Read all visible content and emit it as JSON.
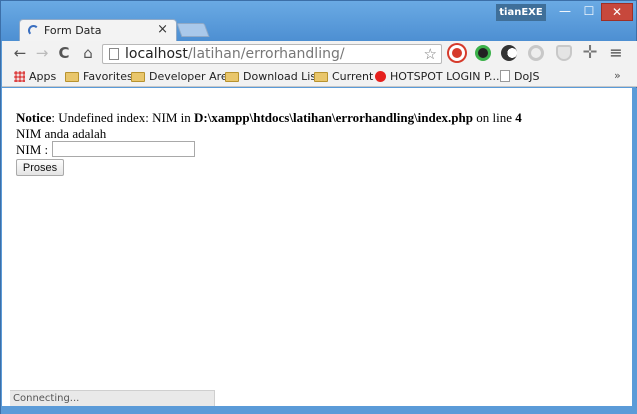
{
  "window": {
    "tab_title": "Form Data",
    "tab_close": "×",
    "user_name": "tianEXE",
    "min": "—",
    "max": "☐",
    "close": "✕"
  },
  "toolbar": {
    "back": "←",
    "forward": "→",
    "reload": "C",
    "home": "⌂",
    "url_host": "localhost",
    "url_path": "/latihan/errorhandling/",
    "star": "☆",
    "extensions_icons": [
      "record-icon",
      "speedometer-icon",
      "moon-icon",
      "circle-icon",
      "shield-icon",
      "crosshair-icon"
    ],
    "menu": "≡"
  },
  "bookmarks": {
    "items": [
      {
        "label": "Apps",
        "icon": "apps-grid-icon"
      },
      {
        "label": "Favorites",
        "icon": "folder-icon"
      },
      {
        "label": "Developer Area",
        "icon": "folder-icon"
      },
      {
        "label": "Download List",
        "icon": "folder-icon"
      },
      {
        "label": "Current",
        "icon": "folder-icon"
      },
      {
        "label": "HOTSPOT LOGIN P...",
        "icon": "red-dot-icon"
      },
      {
        "label": "DoJS",
        "icon": "document-icon"
      }
    ],
    "more": "»"
  },
  "page": {
    "notice_label": "Notice",
    "notice_text_1": ": Undefined index: NIM in ",
    "notice_path": "D:\\xampp\\htdocs\\latihan\\errorhandling\\index.php",
    "notice_text_2": " on line ",
    "notice_line": "4",
    "result_text": "NIM anda adalah",
    "nim_label": "NIM :",
    "nim_value": "",
    "submit_label": "Proses"
  },
  "status": {
    "text": "Connecting..."
  },
  "colors": {
    "frame": "#5b9bd8",
    "close_button": "#c7483c"
  }
}
